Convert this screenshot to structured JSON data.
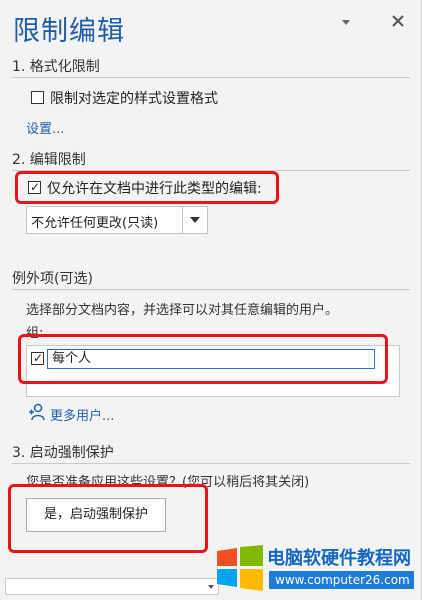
{
  "pane": {
    "title": "限制编辑"
  },
  "formatting": {
    "section_title": "1. 格式化限制",
    "checkbox_label": "限制对选定的样式设置格式",
    "settings_link": "设置..."
  },
  "editing": {
    "section_title": "2. 编辑限制",
    "checkbox_label": "仅允许在文档中进行此类型的编辑:",
    "checkbox_checked": true,
    "dropdown_value": "不允许任何更改(只读)"
  },
  "exceptions": {
    "title": "例外项(可选)",
    "description": "选择部分文档内容，并选择可以对其任意编辑的用户。",
    "groups_label": "组:",
    "group_item": "每个人",
    "group_item_checked": true,
    "more_users_link": "更多用户..."
  },
  "enforcement": {
    "section_title": "3. 启动强制保护",
    "question": "您是否准备应用这些设置？(您可以稍后将其关闭)",
    "button_label": "是，启动强制保护"
  },
  "watermark": {
    "title": "电脑软硬件教程网",
    "url": "www.computer26.com"
  },
  "colors": {
    "accent": "#1f5fa8",
    "highlight_red": "#e8141a"
  }
}
